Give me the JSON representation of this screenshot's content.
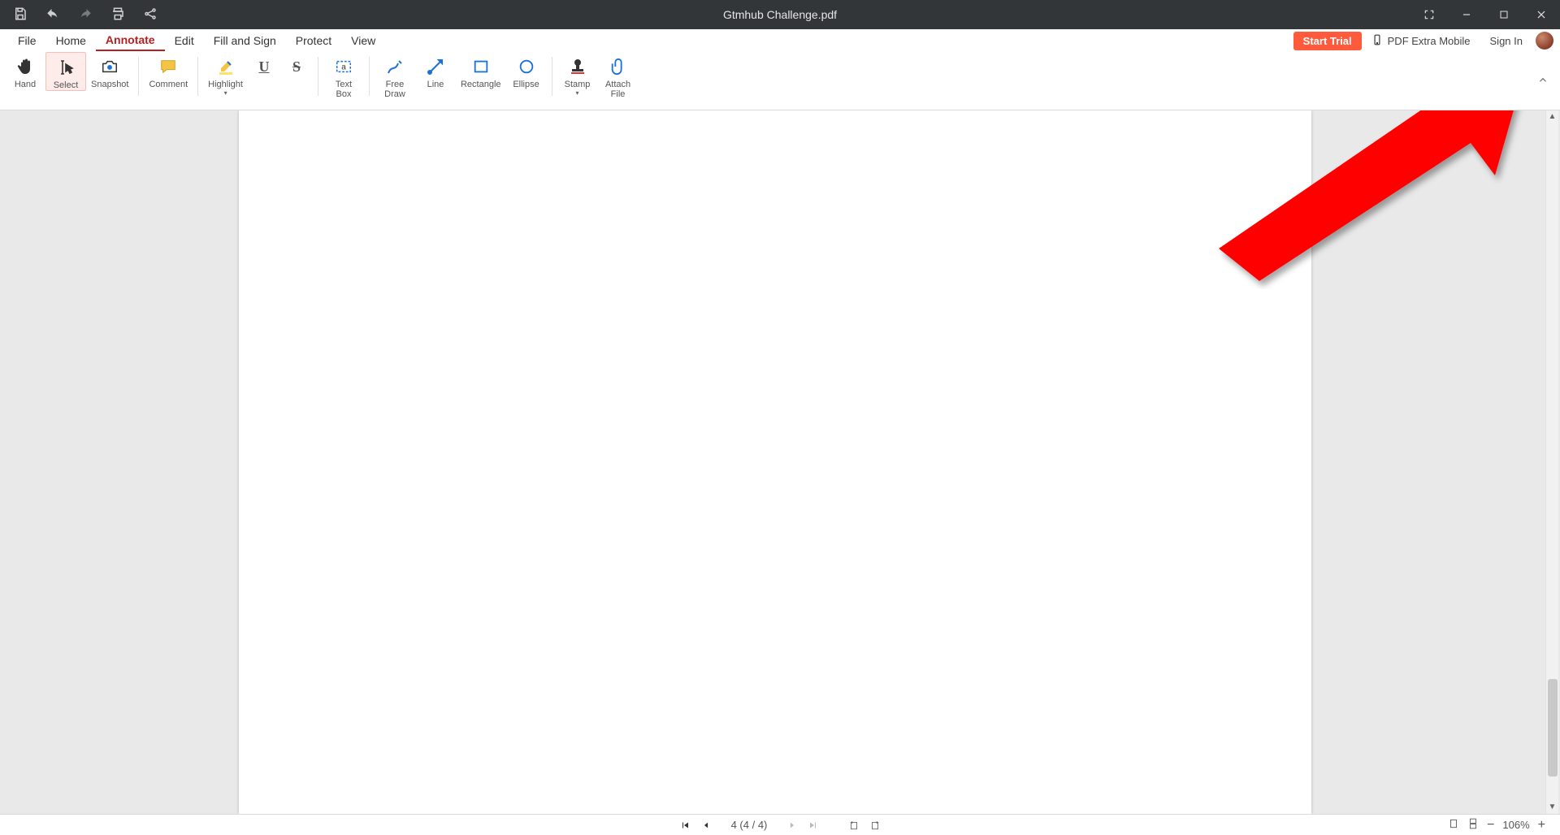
{
  "window": {
    "title": "Gtmhub Challenge.pdf"
  },
  "menu": {
    "items": [
      "File",
      "Home",
      "Annotate",
      "Edit",
      "Fill and Sign",
      "Protect",
      "View"
    ],
    "activeIndex": 2,
    "startTrial": "Start Trial",
    "mobile": "PDF Extra Mobile",
    "signIn": "Sign In"
  },
  "ribbon": {
    "tools": [
      {
        "label": "Hand"
      },
      {
        "label": "Select"
      },
      {
        "label": "Snapshot"
      },
      {
        "label": "Comment"
      },
      {
        "label": "Highlight"
      },
      {
        "label": "Text\nBox"
      },
      {
        "label": "Free\nDraw"
      },
      {
        "label": "Line"
      },
      {
        "label": "Rectangle"
      },
      {
        "label": "Ellipse"
      },
      {
        "label": "Stamp"
      },
      {
        "label": "Attach\nFile"
      }
    ],
    "selectedIndex": 1
  },
  "status": {
    "pageDisplay": "4 (4 / 4)",
    "zoom": "106%"
  }
}
